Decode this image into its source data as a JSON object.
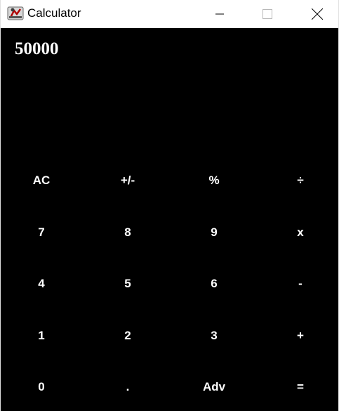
{
  "window": {
    "title": "Calculator"
  },
  "display": {
    "value": "50000"
  },
  "keypad": {
    "rows": [
      [
        "AC",
        "+/-",
        "%",
        "÷"
      ],
      [
        "7",
        "8",
        "9",
        "x"
      ],
      [
        "4",
        "5",
        "6",
        "-"
      ],
      [
        "1",
        "2",
        "3",
        "+"
      ],
      [
        "0",
        ".",
        "Adv",
        "="
      ]
    ]
  },
  "colors": {
    "background": "#000000",
    "text": "#ffffff",
    "titlebar": "#ffffff"
  }
}
